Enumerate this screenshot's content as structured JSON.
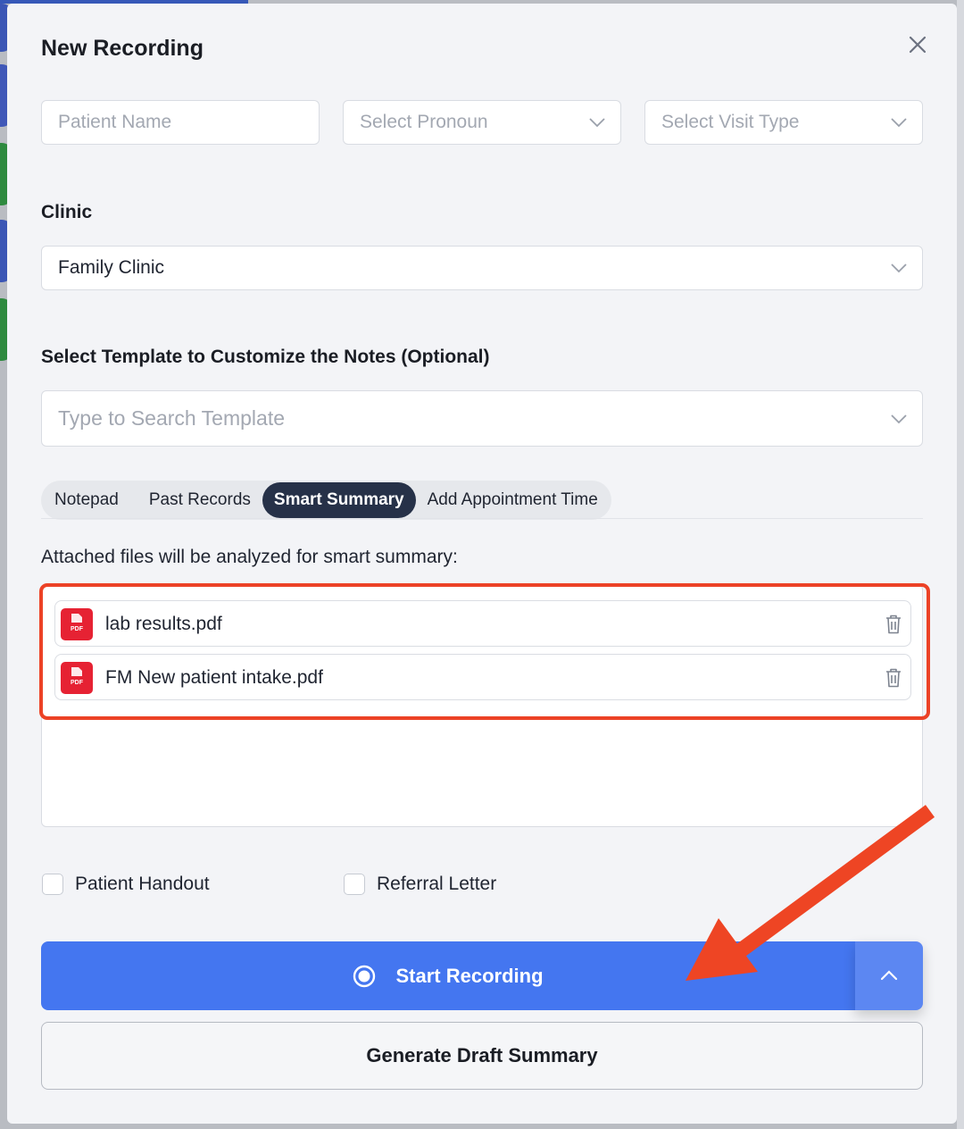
{
  "modal": {
    "title": "New Recording",
    "close_icon": "close-icon"
  },
  "fields": {
    "patient_name_placeholder": "Patient Name",
    "pronoun_placeholder": "Select Pronoun",
    "visit_type_placeholder": "Select Visit Type"
  },
  "clinic": {
    "label": "Clinic",
    "value": "Family Clinic"
  },
  "template": {
    "label": "Select Template to Customize the Notes (Optional)",
    "placeholder": "Type to Search Template"
  },
  "tabs": [
    {
      "label": "Notepad",
      "active": false
    },
    {
      "label": "Past Records",
      "active": false
    },
    {
      "label": "Smart Summary",
      "active": true
    },
    {
      "label": "Add Appointment Time",
      "active": false
    }
  ],
  "smart_summary": {
    "subtitle": "Attached files will be analyzed for smart summary:",
    "files": [
      {
        "name": "lab results.pdf",
        "icon": "pdf-icon",
        "badge": "PDF"
      },
      {
        "name": "FM New patient intake.pdf",
        "icon": "pdf-icon",
        "badge": "PDF"
      }
    ]
  },
  "checkboxes": [
    {
      "label": "Patient Handout",
      "checked": false
    },
    {
      "label": "Referral Letter",
      "checked": false
    }
  ],
  "actions": {
    "start_recording": "Start Recording",
    "generate_draft": "Generate Draft Summary"
  },
  "colors": {
    "primary": "#4476f0",
    "tab_active": "#263148",
    "highlight": "#ec4226",
    "pdf": "#e62233"
  }
}
